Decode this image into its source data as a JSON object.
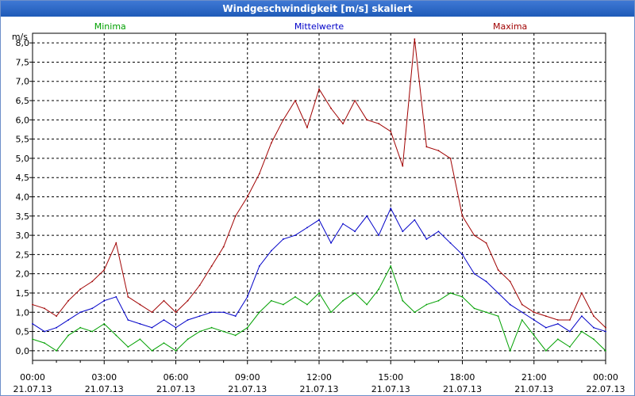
{
  "window": {
    "title": "Windgeschwindigkeit [m/s] skaliert"
  },
  "chart_data": {
    "type": "line",
    "title": "Windgeschwindigkeit [m/s] skaliert",
    "ylabel": "m/s",
    "ylim": [
      -0.25,
      8.25
    ],
    "xlim": [
      0,
      24
    ],
    "grid": true,
    "legend_placement": "top",
    "y_ticks": [
      "0,0",
      "0,5",
      "1,0",
      "1,5",
      "2,0",
      "2,5",
      "3,0",
      "3,5",
      "4,0",
      "4,5",
      "5,0",
      "5,5",
      "6,0",
      "6,5",
      "7,0",
      "7,5",
      "8,0"
    ],
    "x_ticks": [
      {
        "time": "00:00",
        "date": "21.07.13"
      },
      {
        "time": "03:00",
        "date": "21.07.13"
      },
      {
        "time": "06:00",
        "date": "21.07.13"
      },
      {
        "time": "09:00",
        "date": "21.07.13"
      },
      {
        "time": "12:00",
        "date": "21.07.13"
      },
      {
        "time": "15:00",
        "date": "21.07.13"
      },
      {
        "time": "18:00",
        "date": "21.07.13"
      },
      {
        "time": "21:00",
        "date": "21.07.13"
      },
      {
        "time": "00:00",
        "date": "22.07.13"
      }
    ],
    "series": [
      {
        "name": "Minima",
        "color": "#00a000",
        "x": [
          0,
          0.5,
          1,
          1.5,
          2,
          2.5,
          3,
          3.5,
          4,
          4.5,
          5,
          5.5,
          6,
          6.5,
          7,
          7.5,
          8,
          8.5,
          9,
          9.5,
          10,
          10.5,
          11,
          11.5,
          12,
          12.5,
          13,
          13.5,
          14,
          14.5,
          15,
          15.5,
          16,
          16.5,
          17,
          17.5,
          18,
          18.5,
          19,
          19.5,
          20,
          20.5,
          21,
          21.5,
          22,
          22.5,
          23,
          23.5,
          24
        ],
        "values": [
          0.3,
          0.2,
          0.0,
          0.4,
          0.6,
          0.5,
          0.7,
          0.4,
          0.1,
          0.3,
          0.0,
          0.2,
          0.0,
          0.3,
          0.5,
          0.6,
          0.5,
          0.4,
          0.6,
          1.0,
          1.3,
          1.2,
          1.4,
          1.2,
          1.5,
          1.0,
          1.3,
          1.5,
          1.2,
          1.6,
          2.2,
          1.3,
          1.0,
          1.2,
          1.3,
          1.5,
          1.4,
          1.1,
          1.0,
          0.9,
          0.0,
          0.8,
          0.4,
          0.0,
          0.3,
          0.1,
          0.5,
          0.3,
          0.0
        ]
      },
      {
        "name": "Mittelwerte",
        "color": "#0000c8",
        "x": [
          0,
          0.5,
          1,
          1.5,
          2,
          2.5,
          3,
          3.5,
          4,
          4.5,
          5,
          5.5,
          6,
          6.5,
          7,
          7.5,
          8,
          8.5,
          9,
          9.5,
          10,
          10.5,
          11,
          11.5,
          12,
          12.5,
          13,
          13.5,
          14,
          14.5,
          15,
          15.5,
          16,
          16.5,
          17,
          17.5,
          18,
          18.5,
          19,
          19.5,
          20,
          20.5,
          21,
          21.5,
          22,
          22.5,
          23,
          23.5,
          24
        ],
        "values": [
          0.7,
          0.5,
          0.6,
          0.8,
          1.0,
          1.1,
          1.3,
          1.4,
          0.8,
          0.7,
          0.6,
          0.8,
          0.6,
          0.8,
          0.9,
          1.0,
          1.0,
          0.9,
          1.4,
          2.2,
          2.6,
          2.9,
          3.0,
          3.2,
          3.4,
          2.8,
          3.3,
          3.1,
          3.5,
          3.0,
          3.7,
          3.1,
          3.4,
          2.9,
          3.1,
          2.8,
          2.5,
          2.0,
          1.8,
          1.5,
          1.2,
          1.0,
          0.8,
          0.6,
          0.7,
          0.5,
          0.9,
          0.6,
          0.5
        ]
      },
      {
        "name": "Maxima",
        "color": "#a00000",
        "x": [
          0,
          0.5,
          1,
          1.5,
          2,
          2.5,
          3,
          3.5,
          4,
          4.5,
          5,
          5.5,
          6,
          6.5,
          7,
          7.5,
          8,
          8.5,
          9,
          9.5,
          10,
          10.5,
          11,
          11.5,
          12,
          12.5,
          13,
          13.5,
          14,
          14.5,
          15,
          15.5,
          16,
          16.5,
          17,
          17.5,
          18,
          18.5,
          19,
          19.5,
          20,
          20.5,
          21,
          21.5,
          22,
          22.5,
          23,
          23.5,
          24
        ],
        "values": [
          1.2,
          1.1,
          0.9,
          1.3,
          1.6,
          1.8,
          2.1,
          2.8,
          1.4,
          1.2,
          1.0,
          1.3,
          1.0,
          1.3,
          1.7,
          2.2,
          2.7,
          3.5,
          4.0,
          4.6,
          5.4,
          6.0,
          6.5,
          5.8,
          6.8,
          6.3,
          5.9,
          6.5,
          6.0,
          5.9,
          5.7,
          4.8,
          8.1,
          5.3,
          5.2,
          5.0,
          3.5,
          3.0,
          2.8,
          2.1,
          1.8,
          1.2,
          1.0,
          0.9,
          0.8,
          0.8,
          1.5,
          0.9,
          0.6
        ]
      }
    ]
  }
}
